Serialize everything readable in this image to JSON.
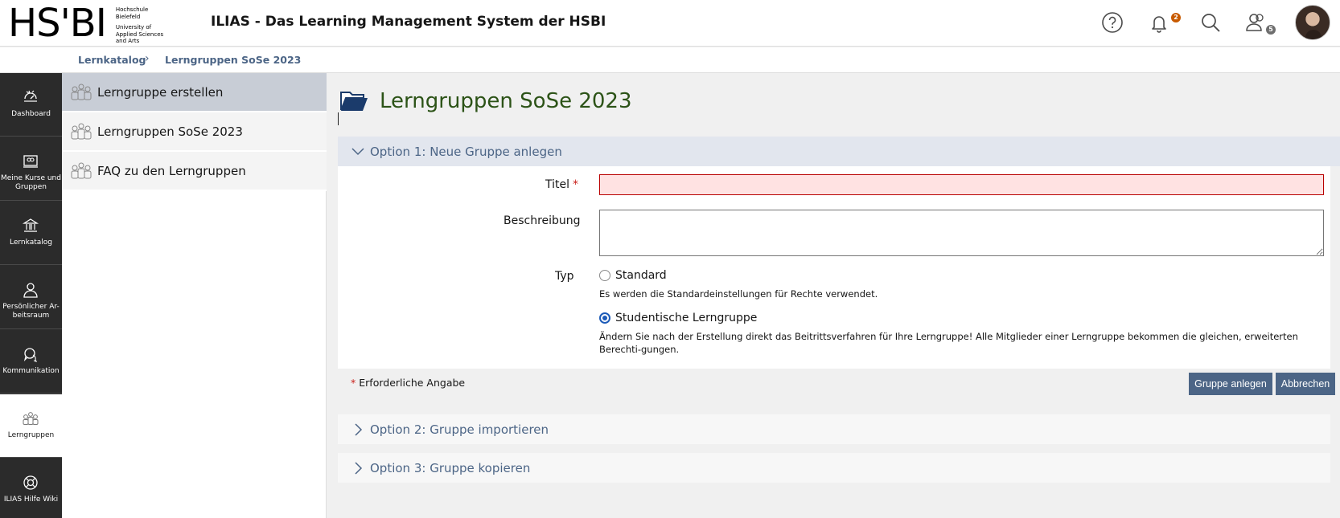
{
  "header": {
    "logo_text": "HS'BI",
    "logo_sub": [
      "Hochschule",
      "Bielefeld",
      "University of",
      "Applied Sciences",
      "and Arts"
    ],
    "title": "ILIAS - Das Learning Management System der HSBI",
    "notifications_count": "2",
    "contacts_count": "5",
    "icons": [
      "help-icon",
      "bell-icon",
      "search-icon",
      "contacts-icon",
      "avatar"
    ]
  },
  "breadcrumb": {
    "items": [
      "Lernkatalog",
      "Lerngruppen SoSe 2023"
    ]
  },
  "mainbar": {
    "items": [
      {
        "label": "Dashboard",
        "icon": "dashboard-icon"
      },
      {
        "label": "Meine Kurse und Gruppen",
        "icon": "courses-icon"
      },
      {
        "label": "Lernkatalog",
        "icon": "catalog-icon"
      },
      {
        "label": "Persönlicher Ar-beitsraum",
        "icon": "personal-workspace-icon"
      },
      {
        "label": "Kommunikation",
        "icon": "communication-icon"
      },
      {
        "label": "Lerngruppen",
        "icon": "groups-icon"
      },
      {
        "label": "ILIAS Hilfe Wiki",
        "icon": "help-wiki-icon"
      }
    ]
  },
  "slate": {
    "items": [
      {
        "label": "Lerngruppe erstellen"
      },
      {
        "label": "Lerngruppen SoSe 2023"
      },
      {
        "label": "FAQ zu den Lerngruppen"
      }
    ]
  },
  "page": {
    "title": "Lerngruppen SoSe 2023"
  },
  "form": {
    "option1_title": "Option 1: Neue Gruppe anlegen",
    "title_label": "Titel",
    "required_mark": "*",
    "title_value": "",
    "description_label": "Beschreibung",
    "description_value": "",
    "type_label": "Typ",
    "type_options": [
      {
        "label": "Standard",
        "selected": false,
        "help": "Es werden die Standardeinstellungen für Rechte verwendet."
      },
      {
        "label": "Studentische Lerngruppe",
        "selected": true,
        "help": "Ändern Sie nach der Erstellung direkt das Beitrittsverfahren für Ihre Lerngruppe! Alle Mitglieder einer Lerngruppe bekommen die gleichen, erweiterten Berechti-gungen."
      }
    ],
    "required_note": "Erforderliche Angabe",
    "create_button": "Gruppe anlegen",
    "cancel_button": "Abbrechen",
    "option2_title": "Option 2: Gruppe importieren",
    "option3_title": "Option 3: Gruppe kopieren"
  },
  "colors": {
    "accent": "#4c6586",
    "title_green": "#2c5317",
    "mainbar_bg": "#2b2b2b",
    "badge_orange": "#c85a00",
    "badge_gray": "#6e6e6e",
    "error_bg": "#ffe2e2"
  }
}
